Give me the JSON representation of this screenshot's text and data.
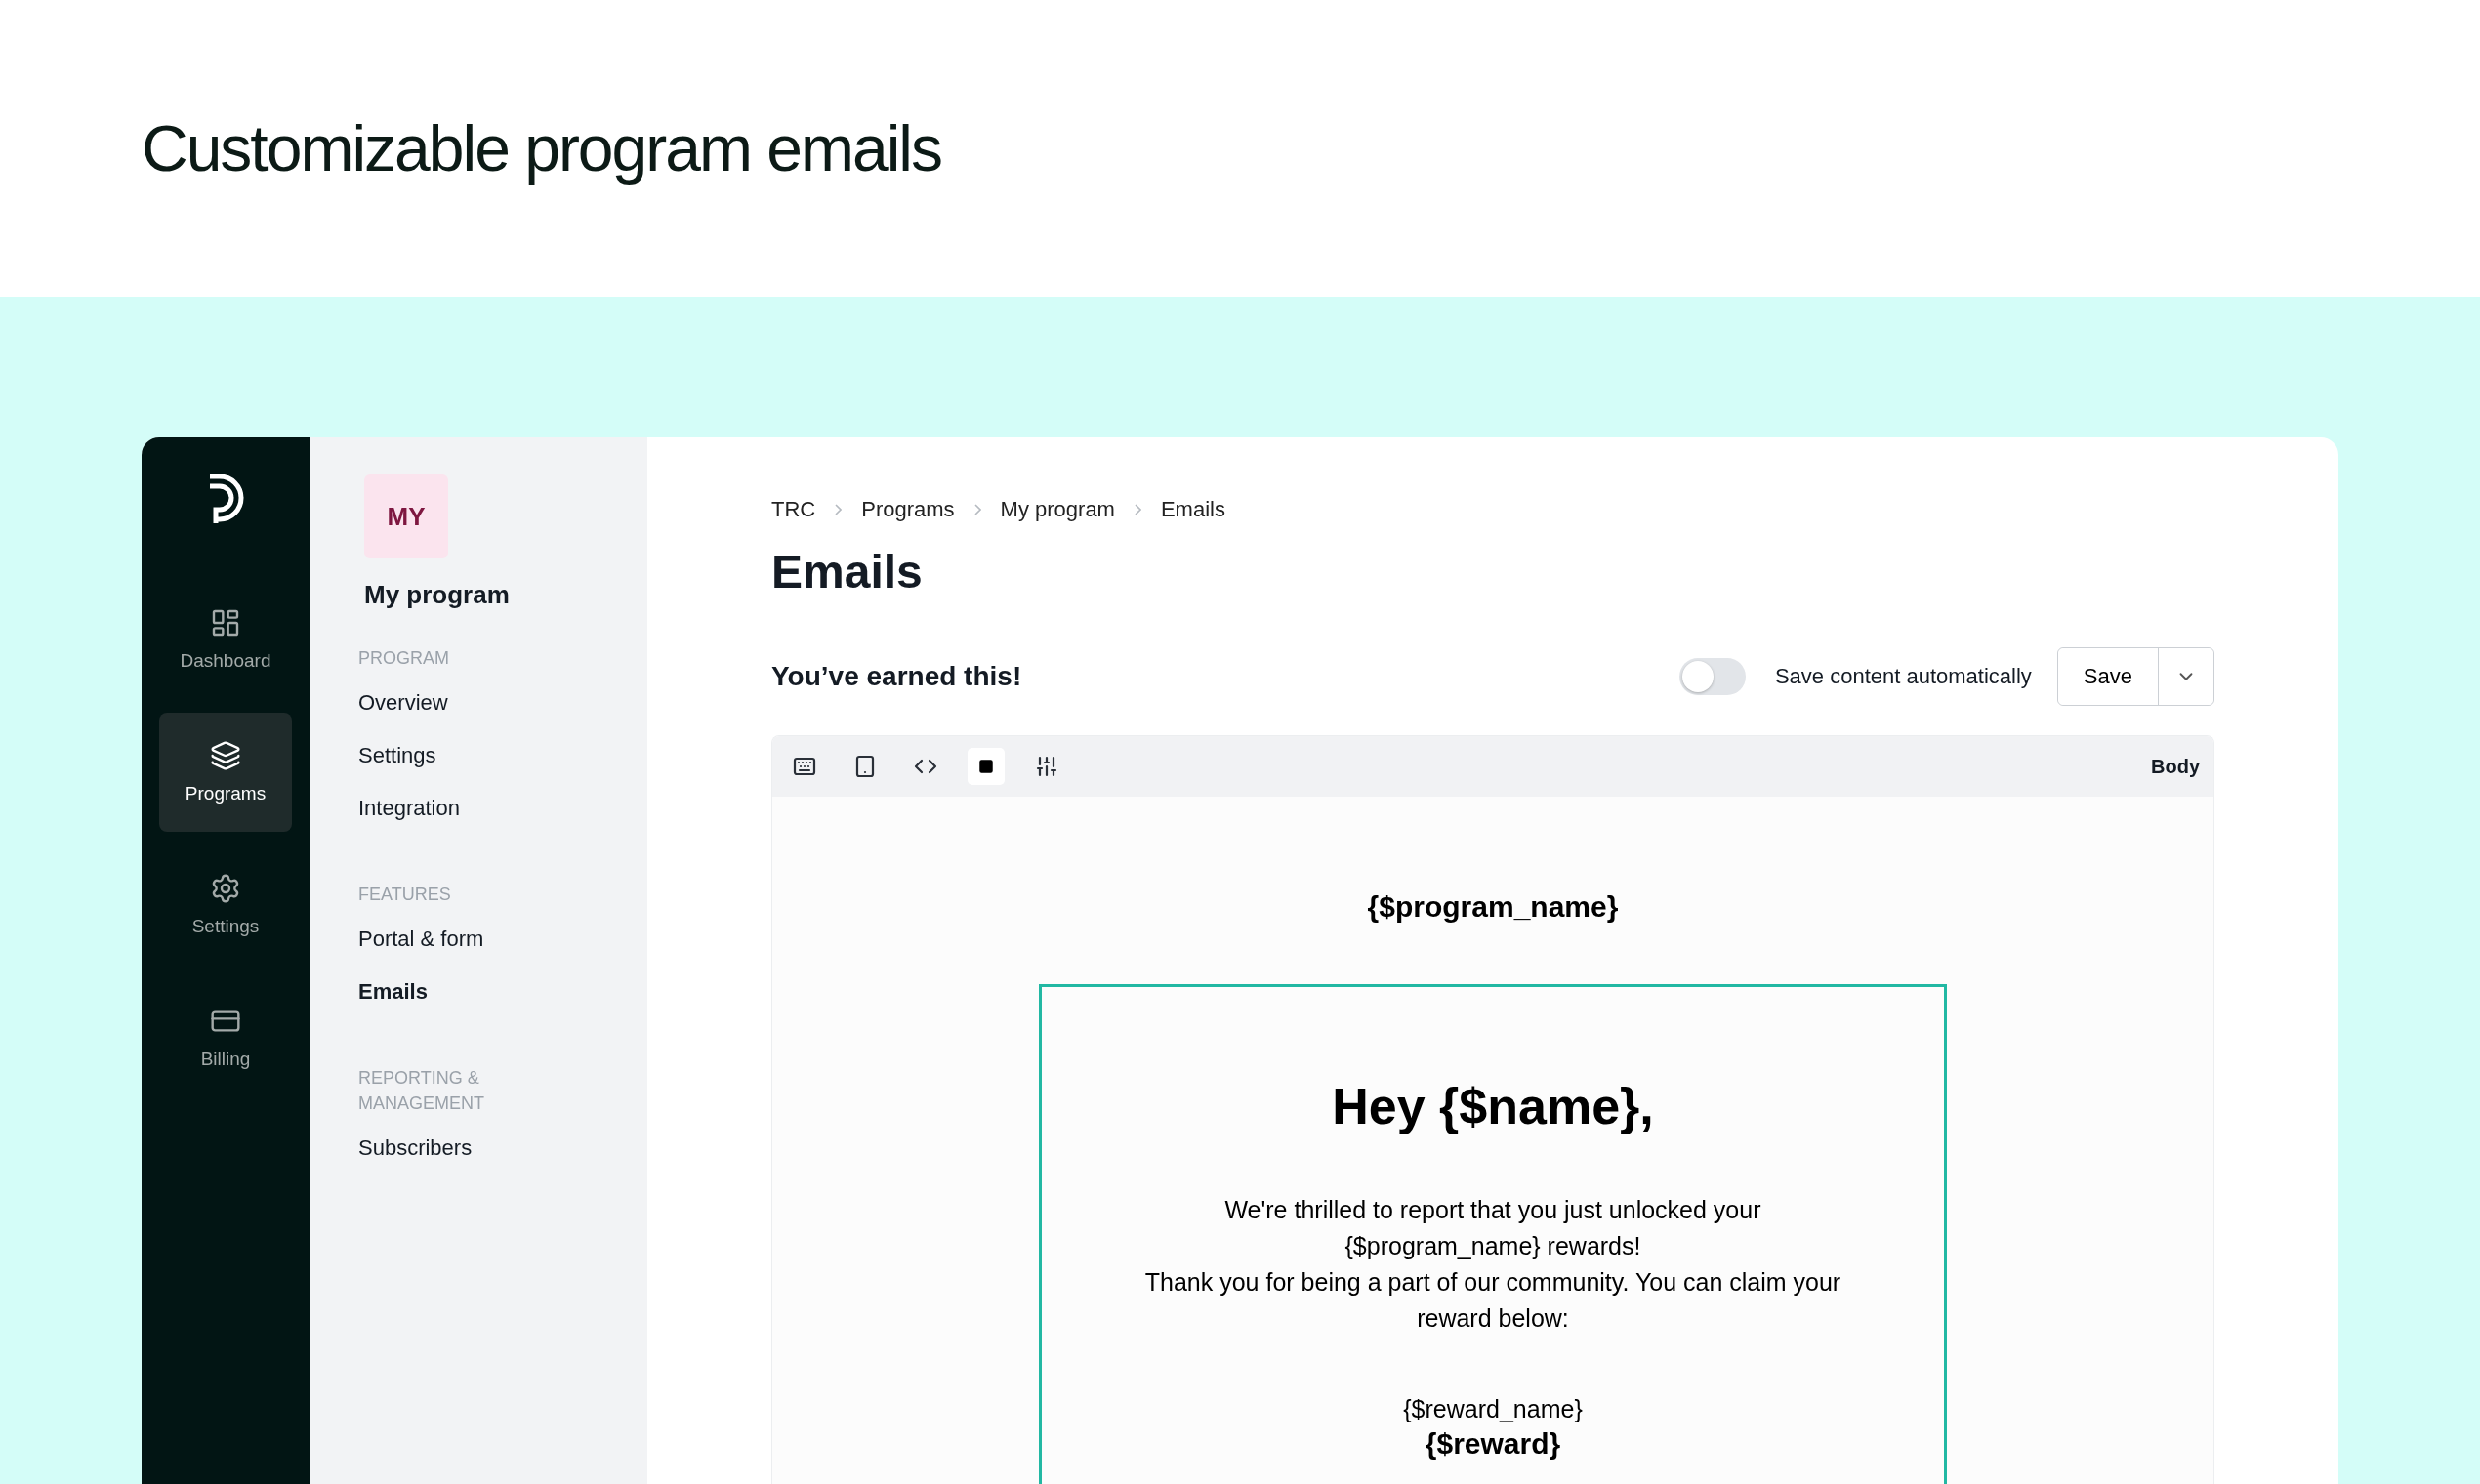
{
  "page_title": "Customizable program emails",
  "rail": {
    "items": [
      {
        "label": "Dashboard",
        "selected": false
      },
      {
        "label": "Programs",
        "selected": true
      },
      {
        "label": "Settings",
        "selected": false
      },
      {
        "label": "Billing",
        "selected": false
      }
    ]
  },
  "program": {
    "avatar": "MY",
    "name": "My program",
    "sections": [
      {
        "heading": "PROGRAM",
        "items": [
          {
            "label": "Overview",
            "selected": false
          },
          {
            "label": "Settings",
            "selected": false
          },
          {
            "label": "Integration",
            "selected": false
          }
        ]
      },
      {
        "heading": "FEATURES",
        "items": [
          {
            "label": "Portal & form",
            "selected": false
          },
          {
            "label": "Emails",
            "selected": true
          }
        ]
      },
      {
        "heading": "REPORTING & MANAGEMENT",
        "items": [
          {
            "label": "Subscribers",
            "selected": false
          }
        ]
      }
    ]
  },
  "breadcrumb": [
    "TRC",
    "Programs",
    "My program",
    "Emails"
  ],
  "heading": "Emails",
  "email": {
    "subject": "You’ve earned this!",
    "autosave": {
      "label": "Save content automatically",
      "on": false
    },
    "save_button": "Save"
  },
  "editor": {
    "tools": [
      {
        "selected": false
      },
      {
        "selected": false
      },
      {
        "selected": false
      },
      {
        "selected": true
      },
      {
        "selected": false
      }
    ],
    "panel_label": "Body",
    "program_name": "{$program_name}",
    "greeting": "Hey {$name},",
    "paragraph_lines": [
      "We're thrilled to report that you just unlocked your",
      "{$program_name} rewards!",
      "Thank you for being a part of our community. You can claim your",
      "reward below:"
    ],
    "reward_name": "{$reward_name}",
    "reward": "{$reward}"
  }
}
